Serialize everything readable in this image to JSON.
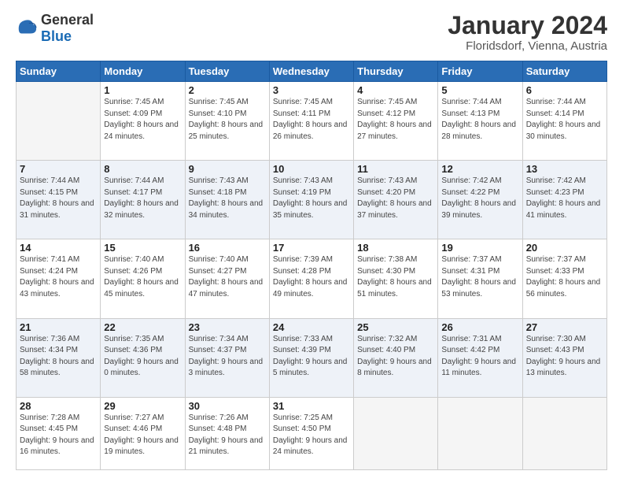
{
  "logo": {
    "general": "General",
    "blue": "Blue"
  },
  "title": "January 2024",
  "subtitle": "Floridsdorf, Vienna, Austria",
  "weekdays": [
    "Sunday",
    "Monday",
    "Tuesday",
    "Wednesday",
    "Thursday",
    "Friday",
    "Saturday"
  ],
  "weeks": [
    [
      {
        "day": "",
        "sunrise": "",
        "sunset": "",
        "daylight": ""
      },
      {
        "day": "1",
        "sunrise": "Sunrise: 7:45 AM",
        "sunset": "Sunset: 4:09 PM",
        "daylight": "Daylight: 8 hours and 24 minutes."
      },
      {
        "day": "2",
        "sunrise": "Sunrise: 7:45 AM",
        "sunset": "Sunset: 4:10 PM",
        "daylight": "Daylight: 8 hours and 25 minutes."
      },
      {
        "day": "3",
        "sunrise": "Sunrise: 7:45 AM",
        "sunset": "Sunset: 4:11 PM",
        "daylight": "Daylight: 8 hours and 26 minutes."
      },
      {
        "day": "4",
        "sunrise": "Sunrise: 7:45 AM",
        "sunset": "Sunset: 4:12 PM",
        "daylight": "Daylight: 8 hours and 27 minutes."
      },
      {
        "day": "5",
        "sunrise": "Sunrise: 7:44 AM",
        "sunset": "Sunset: 4:13 PM",
        "daylight": "Daylight: 8 hours and 28 minutes."
      },
      {
        "day": "6",
        "sunrise": "Sunrise: 7:44 AM",
        "sunset": "Sunset: 4:14 PM",
        "daylight": "Daylight: 8 hours and 30 minutes."
      }
    ],
    [
      {
        "day": "7",
        "sunrise": "Sunrise: 7:44 AM",
        "sunset": "Sunset: 4:15 PM",
        "daylight": "Daylight: 8 hours and 31 minutes."
      },
      {
        "day": "8",
        "sunrise": "Sunrise: 7:44 AM",
        "sunset": "Sunset: 4:17 PM",
        "daylight": "Daylight: 8 hours and 32 minutes."
      },
      {
        "day": "9",
        "sunrise": "Sunrise: 7:43 AM",
        "sunset": "Sunset: 4:18 PM",
        "daylight": "Daylight: 8 hours and 34 minutes."
      },
      {
        "day": "10",
        "sunrise": "Sunrise: 7:43 AM",
        "sunset": "Sunset: 4:19 PM",
        "daylight": "Daylight: 8 hours and 35 minutes."
      },
      {
        "day": "11",
        "sunrise": "Sunrise: 7:43 AM",
        "sunset": "Sunset: 4:20 PM",
        "daylight": "Daylight: 8 hours and 37 minutes."
      },
      {
        "day": "12",
        "sunrise": "Sunrise: 7:42 AM",
        "sunset": "Sunset: 4:22 PM",
        "daylight": "Daylight: 8 hours and 39 minutes."
      },
      {
        "day": "13",
        "sunrise": "Sunrise: 7:42 AM",
        "sunset": "Sunset: 4:23 PM",
        "daylight": "Daylight: 8 hours and 41 minutes."
      }
    ],
    [
      {
        "day": "14",
        "sunrise": "Sunrise: 7:41 AM",
        "sunset": "Sunset: 4:24 PM",
        "daylight": "Daylight: 8 hours and 43 minutes."
      },
      {
        "day": "15",
        "sunrise": "Sunrise: 7:40 AM",
        "sunset": "Sunset: 4:26 PM",
        "daylight": "Daylight: 8 hours and 45 minutes."
      },
      {
        "day": "16",
        "sunrise": "Sunrise: 7:40 AM",
        "sunset": "Sunset: 4:27 PM",
        "daylight": "Daylight: 8 hours and 47 minutes."
      },
      {
        "day": "17",
        "sunrise": "Sunrise: 7:39 AM",
        "sunset": "Sunset: 4:28 PM",
        "daylight": "Daylight: 8 hours and 49 minutes."
      },
      {
        "day": "18",
        "sunrise": "Sunrise: 7:38 AM",
        "sunset": "Sunset: 4:30 PM",
        "daylight": "Daylight: 8 hours and 51 minutes."
      },
      {
        "day": "19",
        "sunrise": "Sunrise: 7:37 AM",
        "sunset": "Sunset: 4:31 PM",
        "daylight": "Daylight: 8 hours and 53 minutes."
      },
      {
        "day": "20",
        "sunrise": "Sunrise: 7:37 AM",
        "sunset": "Sunset: 4:33 PM",
        "daylight": "Daylight: 8 hours and 56 minutes."
      }
    ],
    [
      {
        "day": "21",
        "sunrise": "Sunrise: 7:36 AM",
        "sunset": "Sunset: 4:34 PM",
        "daylight": "Daylight: 8 hours and 58 minutes."
      },
      {
        "day": "22",
        "sunrise": "Sunrise: 7:35 AM",
        "sunset": "Sunset: 4:36 PM",
        "daylight": "Daylight: 9 hours and 0 minutes."
      },
      {
        "day": "23",
        "sunrise": "Sunrise: 7:34 AM",
        "sunset": "Sunset: 4:37 PM",
        "daylight": "Daylight: 9 hours and 3 minutes."
      },
      {
        "day": "24",
        "sunrise": "Sunrise: 7:33 AM",
        "sunset": "Sunset: 4:39 PM",
        "daylight": "Daylight: 9 hours and 5 minutes."
      },
      {
        "day": "25",
        "sunrise": "Sunrise: 7:32 AM",
        "sunset": "Sunset: 4:40 PM",
        "daylight": "Daylight: 9 hours and 8 minutes."
      },
      {
        "day": "26",
        "sunrise": "Sunrise: 7:31 AM",
        "sunset": "Sunset: 4:42 PM",
        "daylight": "Daylight: 9 hours and 11 minutes."
      },
      {
        "day": "27",
        "sunrise": "Sunrise: 7:30 AM",
        "sunset": "Sunset: 4:43 PM",
        "daylight": "Daylight: 9 hours and 13 minutes."
      }
    ],
    [
      {
        "day": "28",
        "sunrise": "Sunrise: 7:28 AM",
        "sunset": "Sunset: 4:45 PM",
        "daylight": "Daylight: 9 hours and 16 minutes."
      },
      {
        "day": "29",
        "sunrise": "Sunrise: 7:27 AM",
        "sunset": "Sunset: 4:46 PM",
        "daylight": "Daylight: 9 hours and 19 minutes."
      },
      {
        "day": "30",
        "sunrise": "Sunrise: 7:26 AM",
        "sunset": "Sunset: 4:48 PM",
        "daylight": "Daylight: 9 hours and 21 minutes."
      },
      {
        "day": "31",
        "sunrise": "Sunrise: 7:25 AM",
        "sunset": "Sunset: 4:50 PM",
        "daylight": "Daylight: 9 hours and 24 minutes."
      },
      {
        "day": "",
        "sunrise": "",
        "sunset": "",
        "daylight": ""
      },
      {
        "day": "",
        "sunrise": "",
        "sunset": "",
        "daylight": ""
      },
      {
        "day": "",
        "sunrise": "",
        "sunset": "",
        "daylight": ""
      }
    ]
  ]
}
